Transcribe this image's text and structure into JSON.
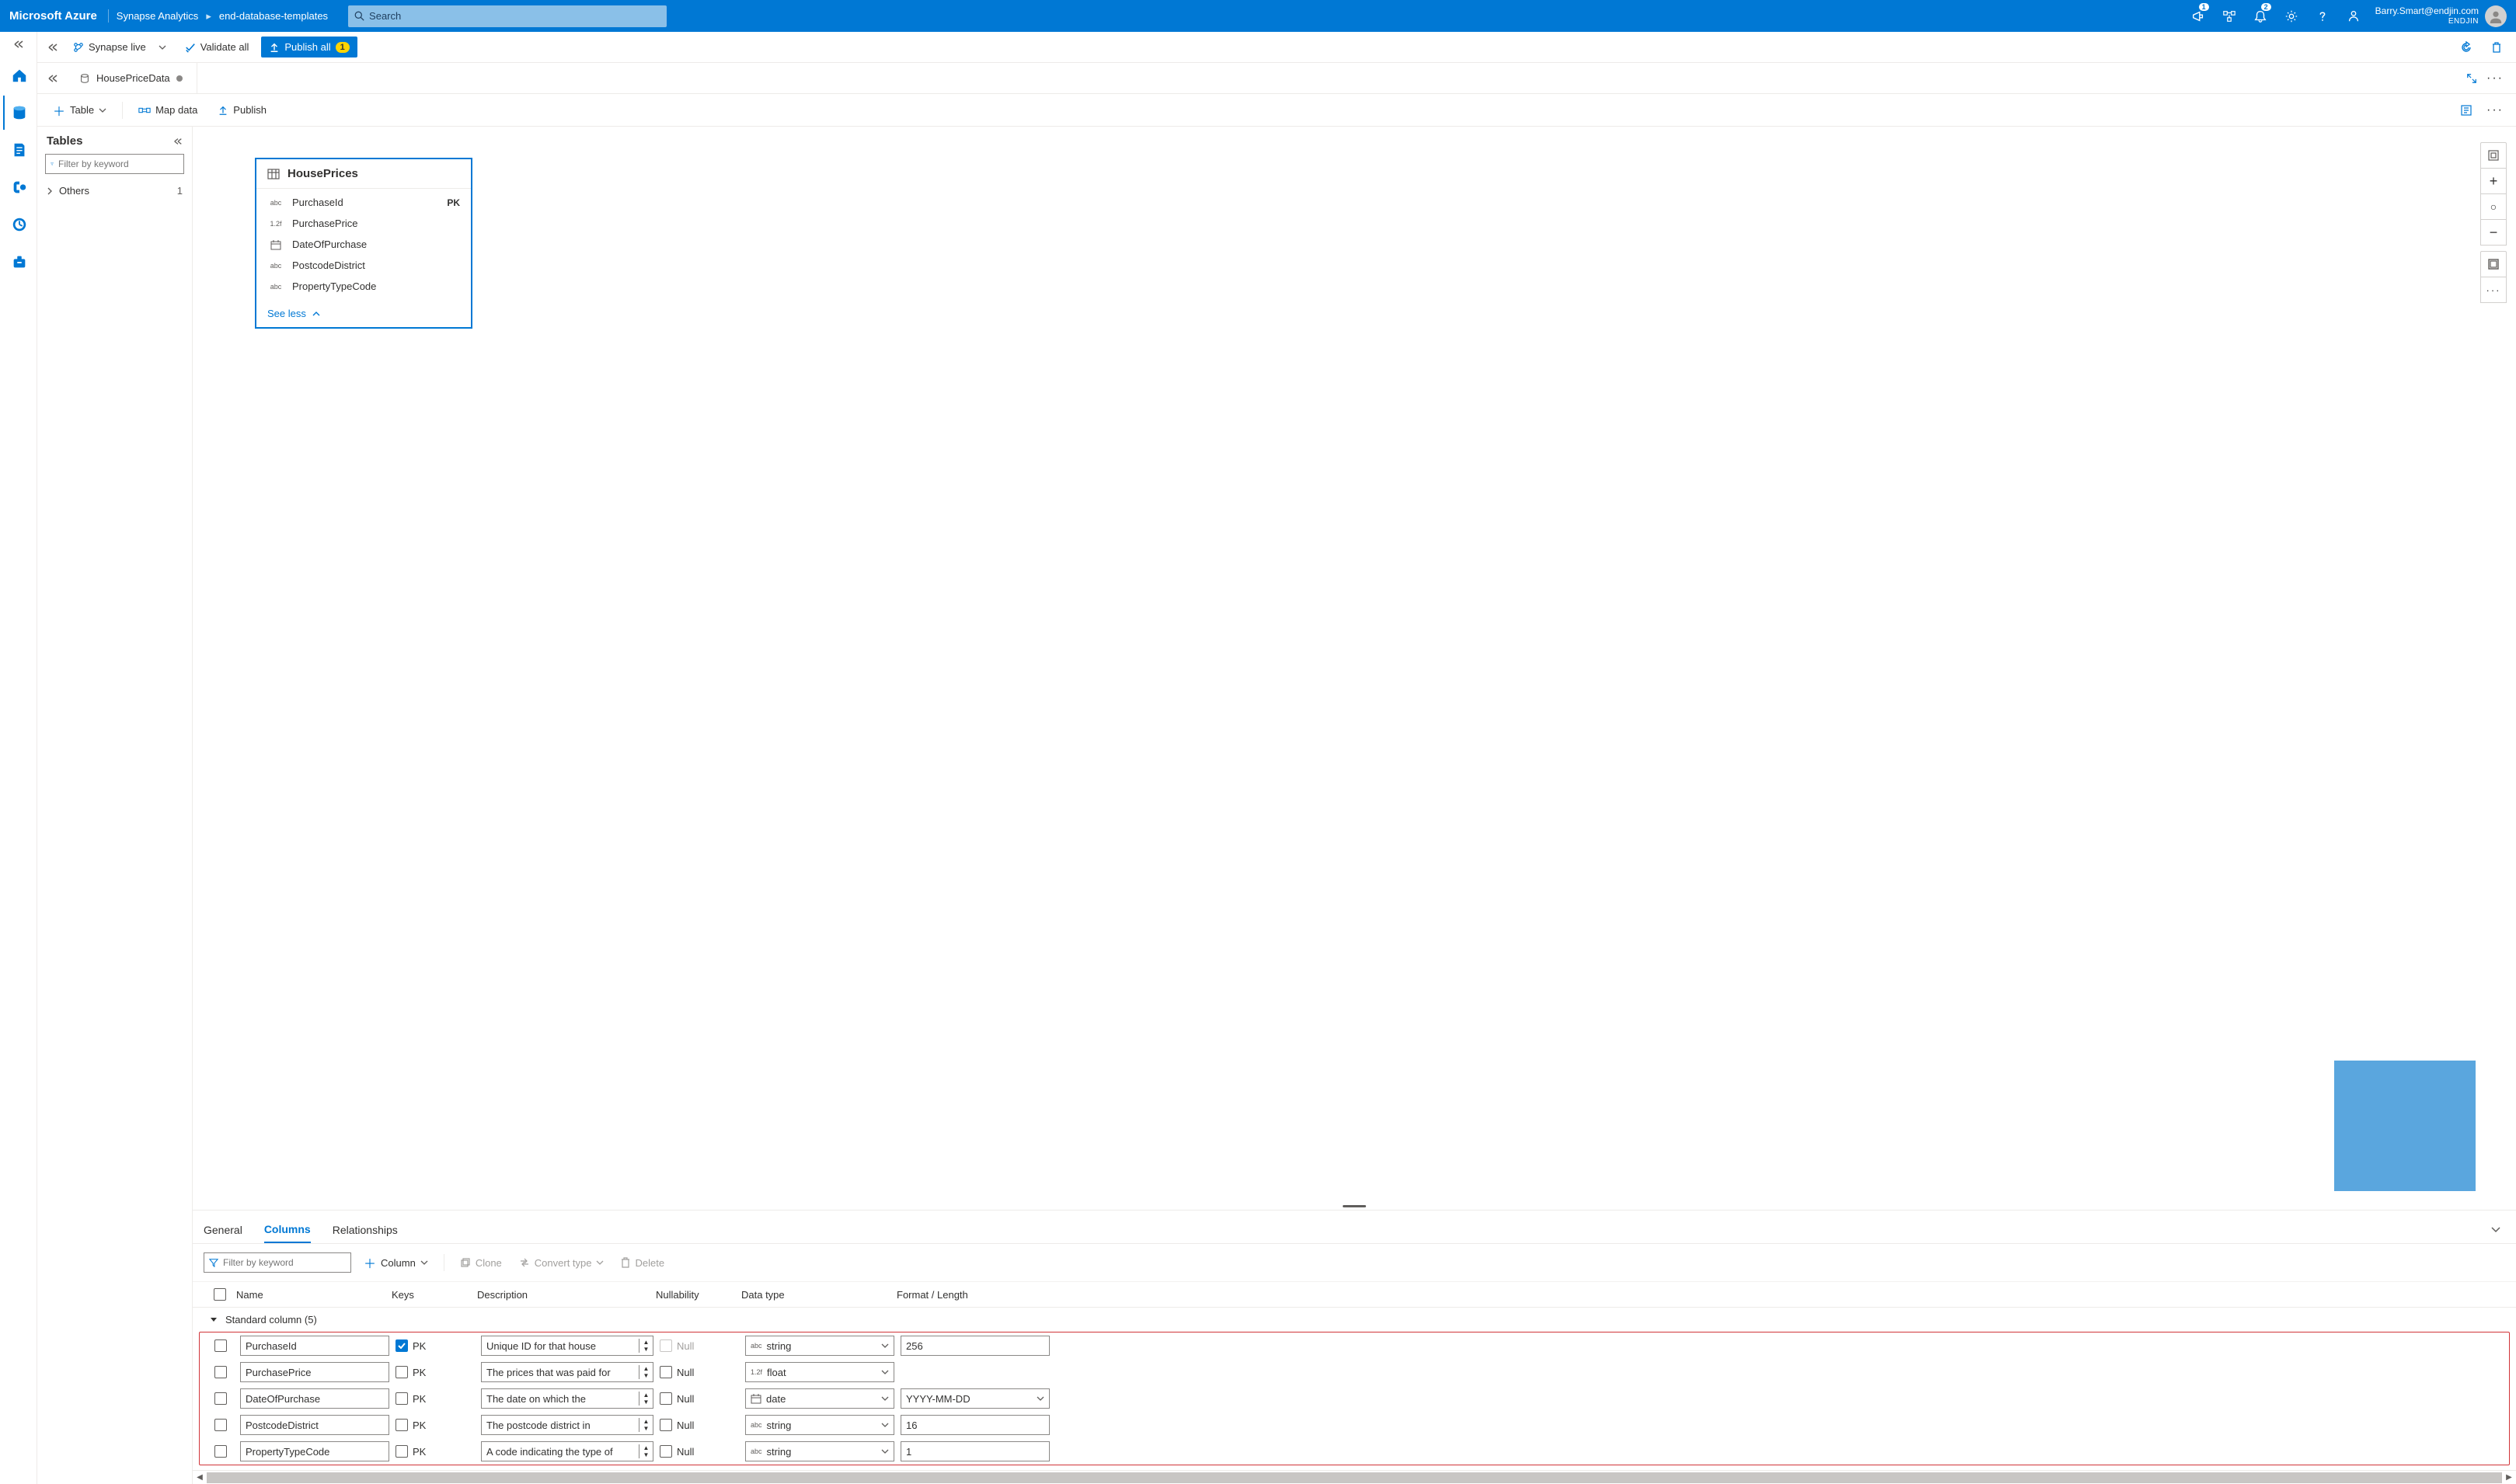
{
  "header": {
    "brand": "Microsoft Azure",
    "crumb1": "Synapse Analytics",
    "crumb2": "end-database-templates",
    "search_placeholder": "Search",
    "announcements_badge": "1",
    "notifications_badge": "2",
    "user_email": "Barry.Smart@endjin.com",
    "user_org": "ENDJIN"
  },
  "commandbar": {
    "synapse_live": "Synapse live",
    "validate_all": "Validate all",
    "publish_all": "Publish all",
    "publish_badge": "1"
  },
  "doc_tab": {
    "title": "HousePriceData"
  },
  "subbar": {
    "table": "Table",
    "map_data": "Map data",
    "publish": "Publish"
  },
  "tables_pane": {
    "title": "Tables",
    "filter_placeholder": "Filter by keyword",
    "others_label": "Others",
    "others_count": "1"
  },
  "entity": {
    "title": "HousePrices",
    "see_less": "See less",
    "rows": [
      {
        "icon": "abc",
        "name": "PurchaseId",
        "pk": "PK"
      },
      {
        "icon": "1.2f",
        "name": "PurchasePrice",
        "pk": ""
      },
      {
        "icon": "date",
        "name": "DateOfPurchase",
        "pk": ""
      },
      {
        "icon": "abc",
        "name": "PostcodeDistrict",
        "pk": ""
      },
      {
        "icon": "abc",
        "name": "PropertyTypeCode",
        "pk": ""
      }
    ]
  },
  "detail": {
    "tabs": {
      "general": "General",
      "columns": "Columns",
      "relationships": "Relationships"
    },
    "filter_placeholder": "Filter by keyword",
    "add_column": "Column",
    "clone": "Clone",
    "convert": "Convert type",
    "delete": "Delete",
    "headers": {
      "name": "Name",
      "keys": "Keys",
      "desc": "Description",
      "null": "Nullability",
      "type": "Data type",
      "fmt": "Format / Length"
    },
    "group_label": "Standard column (5)",
    "pk_label": "PK",
    "null_label": "Null",
    "rows": [
      {
        "name": "PurchaseId",
        "pk": true,
        "desc": "Unique ID for that house",
        "null_disabled": true,
        "type_icon": "abc",
        "type": "string",
        "fmt": "256"
      },
      {
        "name": "PurchasePrice",
        "pk": false,
        "desc": "The prices that was paid for",
        "null_disabled": false,
        "type_icon": "1.2f",
        "type": "float",
        "fmt": ""
      },
      {
        "name": "DateOfPurchase",
        "pk": false,
        "desc": "The date on which the",
        "null_disabled": false,
        "type_icon": "date",
        "type": "date",
        "fmt": "YYYY-MM-DD"
      },
      {
        "name": "PostcodeDistrict",
        "pk": false,
        "desc": "The postcode district in",
        "null_disabled": false,
        "type_icon": "abc",
        "type": "string",
        "fmt": "16"
      },
      {
        "name": "PropertyTypeCode",
        "pk": false,
        "desc": "A code indicating the type of",
        "null_disabled": false,
        "type_icon": "abc",
        "type": "string",
        "fmt": "1"
      }
    ]
  }
}
